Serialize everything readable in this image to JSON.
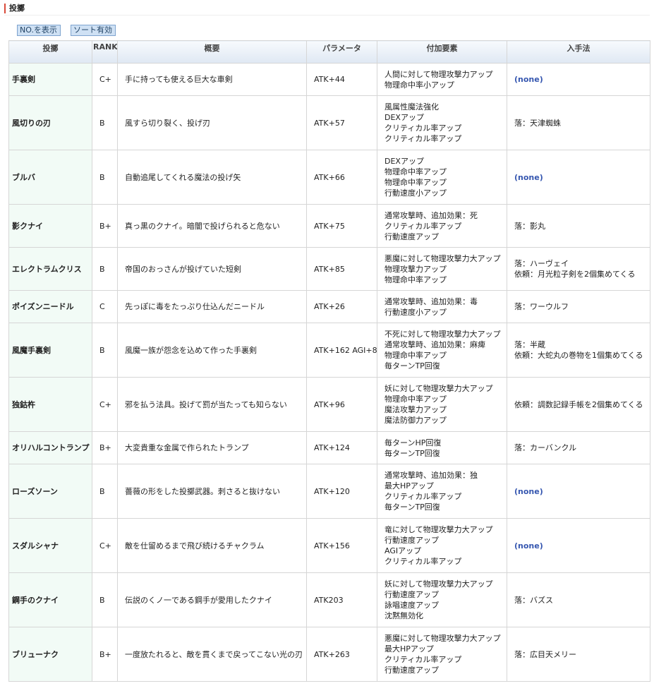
{
  "section": {
    "title": "投擲"
  },
  "toolbar": {
    "show_no_label": "NO.を表示",
    "sort_label": "ソート有効"
  },
  "table": {
    "headers": [
      "投擲",
      "RANK",
      "概要",
      "パラメータ",
      "付加要素",
      "入手法"
    ],
    "rows": [
      {
        "name": "手裏剣",
        "rank": "C+",
        "desc": "手に持っても使える巨大な車剣",
        "param": "ATK+44",
        "bonus": [
          "人間に対して物理攻撃力アップ",
          "物理命中率小アップ"
        ],
        "acq": [
          "(none)"
        ]
      },
      {
        "name": "風切りの刃",
        "rank": "B",
        "desc": "風すら切り裂く、投げ刃",
        "param": "ATK+57",
        "bonus": [
          "風属性魔法強化",
          "DEXアップ",
          "クリティカル率アップ",
          "クリティカル率アップ"
        ],
        "acq": [
          "落：天津蜘蛛"
        ]
      },
      {
        "name": "ブルバ",
        "rank": "B",
        "desc": "自動追尾してくれる魔法の投げ矢",
        "param": "ATK+66",
        "bonus": [
          "DEXアップ",
          "物理命中率アップ",
          "物理命中率アップ",
          "行動速度小アップ"
        ],
        "acq": [
          "(none)"
        ]
      },
      {
        "name": "影クナイ",
        "rank": "B+",
        "desc": "真っ黒のクナイ。暗闇で投げられると危ない",
        "param": "ATK+75",
        "bonus": [
          "通常攻撃時、追加効果：死",
          "クリティカル率アップ",
          "行動速度アップ"
        ],
        "acq": [
          "落：影丸"
        ]
      },
      {
        "name": "エレクトラムクリス",
        "rank": "B",
        "desc": "帝国のおっさんが投げていた短剣",
        "param": "ATK+85",
        "bonus": [
          "悪魔に対して物理攻撃力大アップ",
          "物理攻撃力アップ",
          "物理命中率アップ"
        ],
        "acq": [
          "落：ハーヴェイ",
          "依頼：月光粒子剣を2個集めてくる"
        ]
      },
      {
        "name": "ポイズンニードル",
        "rank": "C",
        "desc": "先っぽに毒をたっぷり仕込んだニードル",
        "param": "ATK+26",
        "bonus": [
          "通常攻撃時、追加効果：毒",
          "行動速度小アップ"
        ],
        "acq": [
          "落：ワーウルフ"
        ]
      },
      {
        "name": "風魔手裏剣",
        "rank": "B",
        "desc": "風魔一族が怨念を込めて作った手裏剣",
        "param": "ATK+162 AGI+8",
        "bonus": [
          "不死に対して物理攻撃力大アップ",
          "通常攻撃時、追加効果：麻痺",
          "物理命中率アップ",
          "毎ターンTP回復"
        ],
        "acq": [
          "落：半蔵",
          "依頼：大蛇丸の巻物を1個集めてくる"
        ]
      },
      {
        "name": "独鈷杵",
        "rank": "C+",
        "desc": "邪を払う法具。投げて罰が当たっても知らない",
        "param": "ATK+96",
        "bonus": [
          "妖に対して物理攻撃力大アップ",
          "物理命中率アップ",
          "魔法攻撃力アップ",
          "魔法防御力アップ"
        ],
        "acq": [
          "依頼：調数記録手帳を2個集めてくる"
        ]
      },
      {
        "name": "オリハルコントランプ",
        "rank": "B+",
        "desc": "大変貴重な金属で作られたトランプ",
        "param": "ATK+124",
        "bonus": [
          "毎ターンHP回復",
          "毎ターンTP回復"
        ],
        "acq": [
          "落：カーバンクル"
        ]
      },
      {
        "name": "ローズソーン",
        "rank": "B",
        "desc": "薔薇の形をした投擲武器。刺さると抜けない",
        "param": "ATK+120",
        "bonus": [
          "通常攻撃時、追加効果：独",
          "最大HPアップ",
          "クリティカル率アップ",
          "毎ターンTP回復"
        ],
        "acq": [
          "(none)"
        ]
      },
      {
        "name": "スダルシャナ",
        "rank": "C+",
        "desc": "敵を仕留めるまで飛び続けるチャクラム",
        "param": "ATK+156",
        "bonus": [
          "竜に対して物理攻撃力大アップ",
          "行動速度アップ",
          "AGIアップ",
          "クリティカル率アップ"
        ],
        "acq": [
          "(none)"
        ]
      },
      {
        "name": "鋼手のクナイ",
        "rank": "B",
        "desc": "伝説のくノ一である鋼手が愛用したクナイ",
        "param": "ATK203",
        "bonus": [
          "妖に対して物理攻撃力大アップ",
          "行動速度アップ",
          "詠唱速度アップ",
          "沈黙無効化"
        ],
        "acq": [
          "落：バズス"
        ]
      },
      {
        "name": "ブリューナク",
        "rank": "B+",
        "desc": "一度放たれると、敵を貫くまで戻ってこない光の刃",
        "param": "ATK+263",
        "bonus": [
          "悪魔に対して物理攻撃力大アップ",
          "最大HPアップ",
          "クリティカル率アップ",
          "行動速度アップ"
        ],
        "acq": [
          "落：広目天メリー"
        ]
      }
    ]
  }
}
